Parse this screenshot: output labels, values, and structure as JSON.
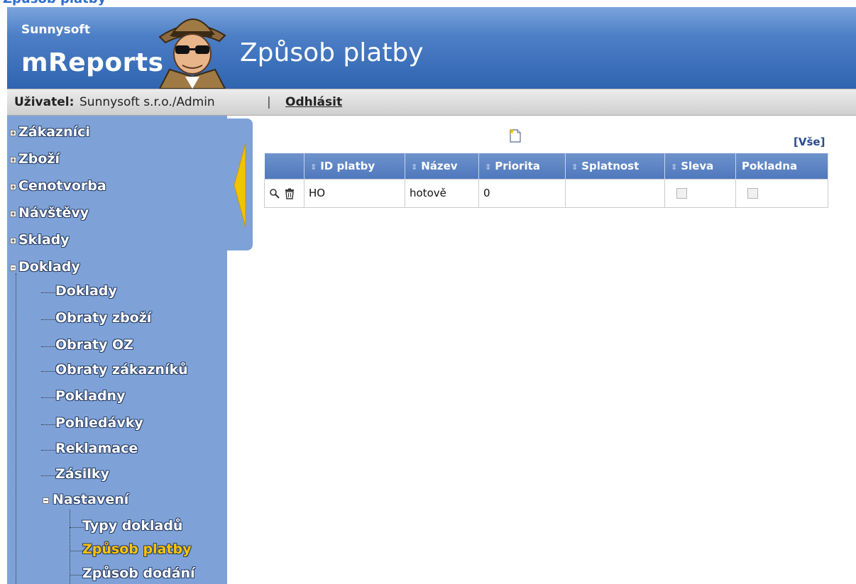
{
  "app": {
    "top_cut_title": "Způsob platby",
    "brand_small": "Sunnysoft",
    "brand_big": "mReports",
    "page_title": "Způsob platby"
  },
  "userbar": {
    "user_label": "Uživatel:",
    "user_value": "Sunnysoft s.r.o./Admin",
    "separator": "|",
    "logout": "Odhlásit"
  },
  "sidebar": {
    "items": [
      {
        "label": "Zákazníci",
        "state": "collapsed"
      },
      {
        "label": "Zboží",
        "state": "collapsed"
      },
      {
        "label": "Cenotvorba",
        "state": "collapsed"
      },
      {
        "label": "Návštěvy",
        "state": "collapsed"
      },
      {
        "label": "Sklady",
        "state": "collapsed"
      },
      {
        "label": "Doklady",
        "state": "expanded"
      }
    ],
    "doklady_children": [
      "Doklady",
      "Obraty zboží",
      "Obraty OZ",
      "Obraty zákazníků",
      "Pokladny",
      "Pohledávky",
      "Reklamace",
      "Zásilky"
    ],
    "nastaveni": {
      "label": "Nastavení",
      "state": "expanded",
      "children": [
        "Typy dokladů",
        "Způsob platby",
        "Způsob dodání"
      ],
      "active": "Způsob platby"
    }
  },
  "toolbar": {
    "new_icon": "new-document-icon",
    "all_link": "[Vše]"
  },
  "grid": {
    "columns": [
      {
        "label": "",
        "sortable": false
      },
      {
        "label": "ID platby",
        "sortable": true
      },
      {
        "label": "Název",
        "sortable": true
      },
      {
        "label": "Priorita",
        "sortable": true
      },
      {
        "label": "Splatnost",
        "sortable": true
      },
      {
        "label": "Sleva",
        "sortable": true
      },
      {
        "label": "Pokladna",
        "sortable": false
      }
    ],
    "rows": [
      {
        "id": "HO",
        "name": "hotově",
        "priority": "0",
        "due": "",
        "discount": false,
        "cash": false
      }
    ],
    "row_icons": [
      "magnifier-icon",
      "trash-icon"
    ]
  },
  "colors": {
    "header_blue": "#2f64b0",
    "sidebar_blue": "#7ea2d8",
    "active_nav": "#ffc400",
    "grid_header": "#5a82c2"
  }
}
